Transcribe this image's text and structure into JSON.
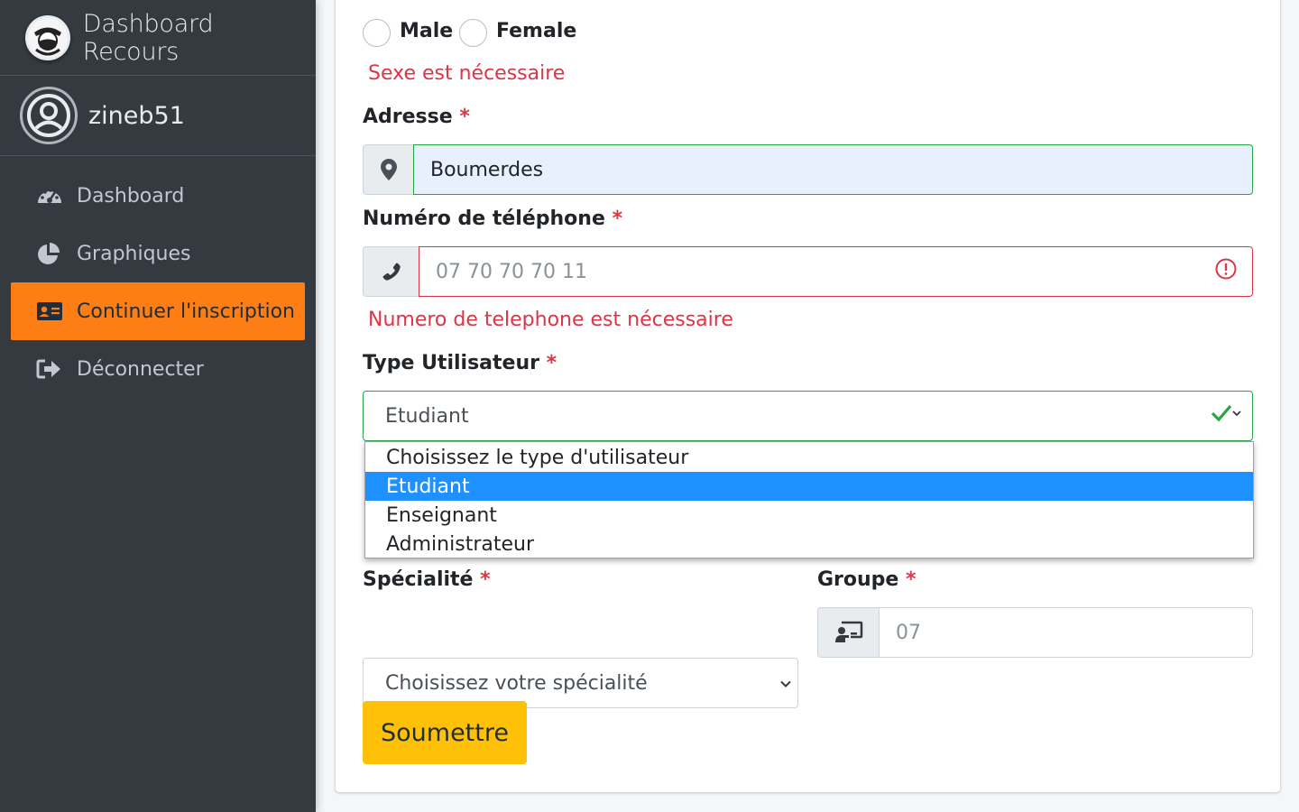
{
  "brand": {
    "title": "Dashboard Recours",
    "logo_icon": "mask-logo-icon"
  },
  "user": {
    "name": "zineb51",
    "avatar_icon": "user-circle-icon"
  },
  "nav": [
    {
      "label": "Dashboard",
      "icon": "tachometer-icon",
      "active": false
    },
    {
      "label": "Graphiques",
      "icon": "pie-chart-icon",
      "active": false
    },
    {
      "label": "Continuer l'inscription",
      "icon": "id-card-icon",
      "active": true
    },
    {
      "label": "Déconnecter",
      "icon": "sign-out-icon",
      "active": false
    }
  ],
  "form": {
    "gender": {
      "options": [
        "Male",
        "Female"
      ],
      "error": "Sexe est nécessaire"
    },
    "address": {
      "label": "Adresse",
      "required": "*",
      "value": "Boumerdes",
      "icon": "map-marker-icon"
    },
    "phone": {
      "label": "Numéro de téléphone",
      "required": "*",
      "placeholder": "07 70 70 70 11",
      "icon": "phone-icon",
      "error": "Numero de telephone est nécessaire"
    },
    "user_type": {
      "label": "Type Utilisateur",
      "required": "*",
      "value": "Etudiant",
      "options": [
        "Choisissez le type d'utilisateur",
        "Etudiant",
        "Enseignant",
        "Administrateur"
      ],
      "selected_index": 1
    },
    "speciality": {
      "label": "Spécialité",
      "required": "*",
      "value": "Choisissez votre spécialité"
    },
    "group": {
      "label": "Groupe",
      "required": "*",
      "placeholder": "07",
      "icon": "chalkboard-teacher-icon"
    },
    "submit_label": "Soumettre"
  },
  "colors": {
    "sidebar": "#343a40",
    "active": "#fd7e14",
    "error": "#dc3545",
    "valid": "#28a745",
    "submit": "#ffc107",
    "highlight": "#1e90ff"
  }
}
